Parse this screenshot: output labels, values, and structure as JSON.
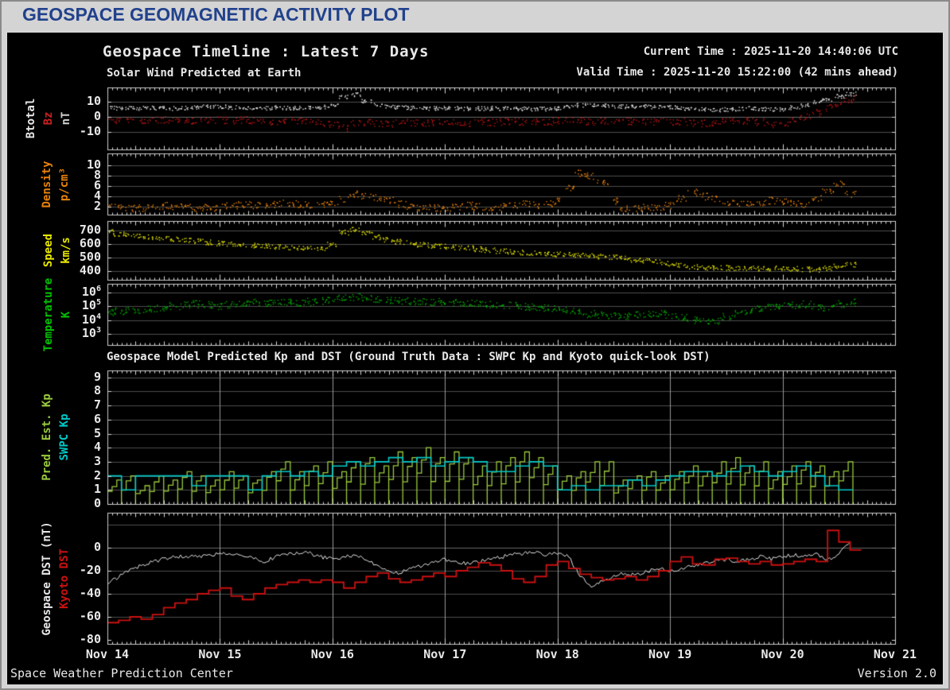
{
  "header": {
    "title": "GEOSPACE GEOMAGNETIC ACTIVITY PLOT"
  },
  "titles": {
    "main": "Geospace Timeline : Latest 7 Days",
    "solar_wind": "Solar Wind Predicted at Earth",
    "current_time": "Current Time : 2025-11-20 14:40:06 UTC",
    "valid_time": "Valid Time : 2025-11-20 15:22:00 (42 mins ahead)",
    "kp_dst": "Geospace Model Predicted Kp and DST (Ground Truth Data : SWPC Kp and Kyoto quick-look DST)"
  },
  "footer": {
    "left": "Space Weather Prediction Center",
    "right": "Version 2.0"
  },
  "colors": {
    "background": "#000000",
    "frame": "#c8c8c8",
    "grid": "#4d4d4d",
    "grid_zero": "#6a6a6a",
    "day_line": "#999999",
    "header_text": "#21418c",
    "white_data": "#e2e2e2",
    "red_data": "#bb1515",
    "orange_data": "#e8820a",
    "yellow_data": "#e0e000",
    "green_data": "#00a800",
    "pred_kp": "#9aca3c",
    "swpc_kp": "#00c8c8",
    "kyoto_red": "#cc1111"
  },
  "x_axis": {
    "labels": [
      "Nov 14",
      "Nov 15",
      "Nov 16",
      "Nov 17",
      "Nov 18",
      "Nov 19",
      "Nov 20",
      "Nov 21"
    ],
    "tick_days": [
      0,
      1,
      2,
      3,
      4,
      5,
      6,
      7
    ],
    "range_days": [
      0,
      7
    ]
  },
  "x_sample": {
    "start_day": 0,
    "step_day": 0.1,
    "count": 67
  },
  "kp_sample": {
    "start_day": 0,
    "step_hours": 3,
    "count": 53
  },
  "chart_data": [
    {
      "id": "solar-wind-bfield",
      "type": "scatter",
      "ylabels": [
        {
          "text": "Btotal",
          "color": "#e8e8e8"
        },
        {
          "text": "Bz",
          "color": "#cc2020"
        },
        {
          "text": "nT",
          "color": "#cccccc"
        }
      ],
      "ylim": [
        -21,
        20
      ],
      "yticks": [
        [
          10,
          "10"
        ],
        [
          0,
          "0"
        ],
        [
          -10,
          "-10"
        ]
      ],
      "gridlines": [
        10,
        0,
        -10
      ],
      "series": [
        {
          "name": "Btotal",
          "color": "#e2e2e2",
          "values": [
            6.5,
            6.2,
            6.0,
            6.0,
            6.2,
            6.0,
            5.8,
            6.0,
            6.5,
            7.0,
            7.0,
            6.5,
            6.2,
            6.0,
            6.2,
            6.5,
            6.3,
            6.0,
            6.2,
            6.8,
            8.0,
            13.5,
            15.0,
            10.5,
            8.0,
            7.0,
            6.5,
            6.2,
            6.0,
            6.0,
            6.2,
            6.0,
            5.8,
            5.8,
            6.0,
            5.8,
            5.6,
            5.8,
            5.6,
            5.5,
            5.8,
            7.5,
            8.0,
            7.8,
            7.5,
            7.5,
            7.2,
            7.0,
            7.0,
            6.8,
            6.5,
            6.0,
            5.5,
            5.2,
            5.0,
            5.2,
            5.5,
            5.8,
            5.5,
            5.2,
            5.5,
            6.5,
            8.0,
            10.0,
            12.0,
            14.0,
            15.5
          ]
        },
        {
          "name": "Bz",
          "color": "#bb1515",
          "values": [
            -1.5,
            -2,
            -1.8,
            -2.2,
            -2,
            -1.5,
            -1.8,
            -2.5,
            -2,
            -1.5,
            -2,
            -2.2,
            -1.8,
            -2,
            -2.8,
            -2.5,
            -2,
            -2.5,
            -3,
            -3.5,
            -5,
            -7,
            -4,
            -3,
            -4,
            -4.5,
            -4,
            -3.5,
            -4,
            -3.5,
            -3,
            -3.5,
            -4,
            -3,
            -3.5,
            -3,
            -2.8,
            -3,
            -3.2,
            -3,
            -2.2,
            -1.8,
            -2.2,
            -2.8,
            -2.2,
            -2,
            -2.5,
            -3,
            -3.2,
            -3,
            -2.8,
            -3,
            -3.8,
            -4,
            -3.5,
            -3,
            -2.2,
            -2,
            -3,
            -4.5,
            -3.5,
            -1.5,
            0.5,
            3,
            6,
            9,
            12
          ]
        }
      ]
    },
    {
      "id": "density",
      "type": "scatter",
      "ylabels": [
        {
          "text": "Density",
          "color": "#e8820a"
        },
        {
          "text": "p/cm³",
          "color": "#e8820a"
        }
      ],
      "ylim": [
        0,
        12
      ],
      "yticks": [
        [
          10,
          "10"
        ],
        [
          8,
          "8"
        ],
        [
          6,
          "6"
        ],
        [
          4,
          "4"
        ],
        [
          2,
          "2"
        ]
      ],
      "gridlines": [
        2,
        4,
        6,
        8,
        10
      ],
      "series": [
        {
          "name": "Density",
          "color": "#e8820a",
          "values": [
            2,
            1.8,
            1.7,
            1.8,
            2,
            2.2,
            2,
            1.8,
            1.7,
            1.8,
            2,
            2.2,
            2.5,
            2.3,
            2.2,
            2.5,
            2.8,
            2.5,
            2.3,
            2.5,
            2.7,
            3.5,
            4.5,
            4.2,
            3.8,
            3.2,
            2.5,
            2,
            1.8,
            1.7,
            1.8,
            2,
            2.2,
            2,
            1.8,
            2,
            2.2,
            2.5,
            2.3,
            2.5,
            3,
            5.5,
            8.5,
            8,
            6.5,
            3,
            1.8,
            1.7,
            1.8,
            2,
            2.2,
            3.5,
            4.8,
            4,
            3.5,
            3,
            2.8,
            2.5,
            2.8,
            3.2,
            3,
            2.8,
            2.5,
            3.5,
            5,
            6.5,
            4.5
          ]
        }
      ]
    },
    {
      "id": "speed",
      "type": "scatter",
      "ylabels": [
        {
          "text": "Speed",
          "color": "#e8e800"
        },
        {
          "text": "km/s",
          "color": "#e8e800"
        }
      ],
      "ylim": [
        335,
        770
      ],
      "yticks": [
        [
          700,
          "700"
        ],
        [
          600,
          "600"
        ],
        [
          500,
          "500"
        ],
        [
          400,
          "400"
        ]
      ],
      "gridlines": [
        400,
        500,
        600,
        700
      ],
      "series": [
        {
          "name": "Speed",
          "color": "#e0e000",
          "values": [
            690,
            680,
            672,
            663,
            655,
            648,
            640,
            632,
            624,
            616,
            608,
            600,
            596,
            592,
            588,
            584,
            580,
            576,
            572,
            566,
            600,
            690,
            715,
            685,
            655,
            635,
            620,
            610,
            600,
            592,
            585,
            578,
            572,
            565,
            558,
            552,
            546,
            540,
            535,
            530,
            528,
            524,
            520,
            516,
            512,
            508,
            498,
            488,
            478,
            470,
            460,
            445,
            435,
            430,
            430,
            428,
            426,
            425,
            424,
            423,
            424,
            420,
            415,
            414,
            424,
            438,
            452
          ]
        }
      ]
    },
    {
      "id": "temperature",
      "type": "scatter",
      "log": true,
      "ylabels": [
        {
          "text": "Temperature",
          "color": "#00c000"
        },
        {
          "text": "K",
          "color": "#00c000"
        }
      ],
      "ylim": [
        160,
        4000000
      ],
      "yticks": [
        [
          1000000,
          "10^6"
        ],
        [
          100000,
          "10^5"
        ],
        [
          10000,
          "10^4"
        ],
        [
          1000,
          "10^3"
        ]
      ],
      "gridlines": [
        1000000,
        100000,
        10000,
        1000
      ],
      "series": [
        {
          "name": "Temperature",
          "color": "#00a800",
          "values": [
            40000,
            45000,
            50000,
            60000,
            75000,
            90000,
            110000,
            130000,
            150000,
            130000,
            110000,
            140000,
            170000,
            200000,
            180000,
            200000,
            220000,
            200000,
            220000,
            260000,
            320000,
            420000,
            500000,
            450000,
            360000,
            300000,
            280000,
            250000,
            230000,
            220000,
            210000,
            200000,
            180000,
            160000,
            150000,
            130000,
            120000,
            100000,
            90000,
            80000,
            70000,
            50000,
            40000,
            30000,
            25000,
            20000,
            22000,
            26000,
            30000,
            30000,
            25000,
            18000,
            11000,
            8000,
            9500,
            20000,
            32000,
            50000,
            80000,
            90000,
            105000,
            120000,
            150000,
            100000,
            85000,
            150000,
            200000
          ]
        }
      ]
    },
    {
      "id": "kp",
      "type": "step",
      "day_lines": true,
      "ylabels": [
        {
          "text": "Pred. Est. Kp",
          "color": "#9aca3c"
        },
        {
          "text": "SWPC Kp",
          "color": "#00c8c8"
        }
      ],
      "ylim": [
        0,
        9.5
      ],
      "yticks": [
        [
          9,
          "9"
        ],
        [
          8,
          "8"
        ],
        [
          7,
          "7"
        ],
        [
          6,
          "6"
        ],
        [
          5,
          "5"
        ],
        [
          4,
          "4"
        ],
        [
          3,
          "3"
        ],
        [
          2,
          "2"
        ],
        [
          1,
          "1"
        ],
        [
          0,
          "0"
        ]
      ],
      "gridlines": [
        1,
        2,
        3,
        4,
        5,
        6,
        7,
        8,
        9
      ],
      "series": [
        {
          "name": "Pred. Est. Kp",
          "color": "#9aca3c",
          "style": "sawtooth",
          "step_hours": 3,
          "values": [
            1.7,
            2,
            1.3,
            2,
            1.7,
            2.3,
            2,
            1.7,
            2.3,
            2,
            1.7,
            2.3,
            3,
            2.3,
            2.7,
            3,
            2.3,
            3,
            3.3,
            2.7,
            3.7,
            3.3,
            4,
            3.3,
            3.7,
            3.3,
            2.7,
            3,
            3.3,
            3.7,
            3.3,
            2.7,
            2,
            2.3,
            3,
            3,
            1.7,
            2,
            2.3,
            2,
            2.3,
            2.7,
            2.3,
            3,
            3.3,
            2.7,
            3,
            2.3,
            2.7,
            3,
            2.7,
            2.3,
            3
          ]
        },
        {
          "name": "SWPC Kp",
          "color": "#00c8c8",
          "style": "step",
          "step_hours": 3,
          "values": [
            2,
            1,
            2,
            2,
            2,
            2,
            1.3,
            2,
            2,
            2,
            1,
            2,
            2.3,
            2,
            2.3,
            2,
            2.7,
            3,
            2.7,
            3,
            3.3,
            3,
            3.3,
            2.7,
            3,
            3.3,
            3,
            2.3,
            2.3,
            2.7,
            3,
            2.7,
            1,
            1.3,
            1,
            1.3,
            1.3,
            1.7,
            1.3,
            1.7,
            2,
            2.3,
            2.3,
            2,
            2.3,
            2.7,
            2.3,
            2,
            2.3,
            2.7,
            2,
            1.3,
            1
          ]
        }
      ]
    },
    {
      "id": "dst",
      "type": "line",
      "day_lines": true,
      "ylabels": [
        {
          "text": "Geospace DST (nT)",
          "color": "#e8e8e8"
        },
        {
          "text": "Kyoto DST",
          "color": "#cc1111"
        }
      ],
      "ylim": [
        -83,
        30
      ],
      "yticks": [
        [
          0,
          "0"
        ],
        [
          -20,
          "-20"
        ],
        [
          -40,
          "-40"
        ],
        [
          -60,
          "-60"
        ],
        [
          -80,
          "-80"
        ]
      ],
      "gridlines": [
        20,
        0,
        -20,
        -40,
        -60
      ],
      "series": [
        {
          "name": "Geospace DST",
          "color": "#e8e8e8",
          "style": "noisy",
          "values": [
            -32,
            -25,
            -20,
            -15,
            -12,
            -10,
            -8,
            -7,
            -8,
            -6,
            -5,
            -6,
            -7,
            -9,
            -12,
            -8,
            -5,
            -4,
            -5,
            -8,
            -10,
            -8,
            -6,
            -10,
            -15,
            -20,
            -22,
            -18,
            -15,
            -12,
            -10,
            -12,
            -14,
            -12,
            -10,
            -8,
            -6,
            -5,
            -4,
            -6,
            -5,
            -8,
            -25,
            -33,
            -28,
            -25,
            -22,
            -24,
            -20,
            -18,
            -20,
            -18,
            -16,
            -14,
            -12,
            -10,
            -12,
            -10,
            -8,
            -10,
            -8,
            -6,
            -8,
            -6,
            -10,
            -6,
            5
          ]
        },
        {
          "name": "Kyoto DST",
          "color": "#cc1111",
          "style": "step",
          "values": [
            -65,
            -63,
            -60,
            -62,
            -58,
            -52,
            -48,
            -45,
            -40,
            -37,
            -35,
            -42,
            -45,
            -40,
            -35,
            -32,
            -30,
            -28,
            -30,
            -28,
            -30,
            -35,
            -30,
            -25,
            -22,
            -27,
            -30,
            -28,
            -25,
            -22,
            -25,
            -20,
            -17,
            -13,
            -15,
            -20,
            -27,
            -30,
            -25,
            -15,
            -12,
            -18,
            -23,
            -26,
            -28,
            -27,
            -25,
            -28,
            -25,
            -20,
            -12,
            -8,
            -14,
            -15,
            -10,
            -9,
            -12,
            -14,
            -12,
            -15,
            -14,
            -12,
            -10,
            -12,
            15,
            5,
            -2
          ]
        }
      ]
    }
  ]
}
